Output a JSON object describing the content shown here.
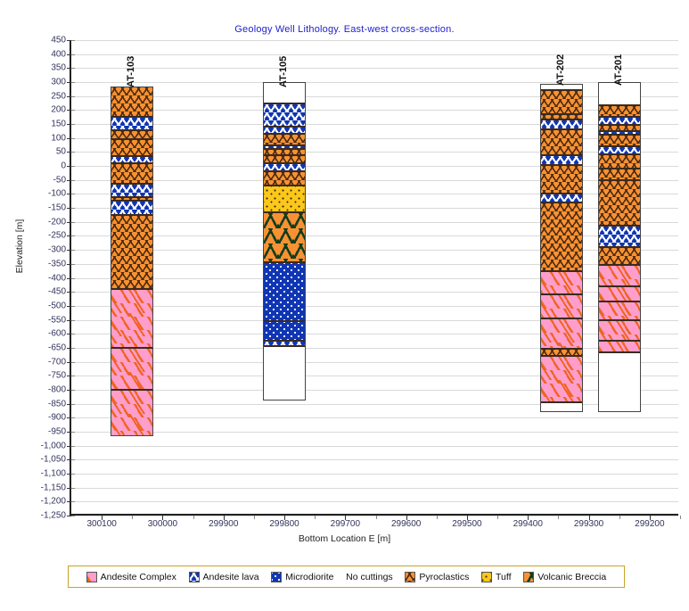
{
  "chart_title": "Geology Well Lithology.  East-west cross-section.",
  "axes": {
    "x_title": "Bottom Location E [m]",
    "y_title": "Elevation [m]",
    "x_ticks": [
      "300100",
      "300000",
      "299900",
      "299800",
      "299700",
      "299600",
      "299500",
      "299400",
      "299300",
      "299200"
    ],
    "y_ticks": [
      "450",
      "400",
      "350",
      "300",
      "250",
      "200",
      "150",
      "100",
      "50",
      "0",
      "-50",
      "-100",
      "-150",
      "-200",
      "-250",
      "-300",
      "-350",
      "-400",
      "-450",
      "-500",
      "-550",
      "-600",
      "-650",
      "-700",
      "-750",
      "-800",
      "-850",
      "-900",
      "-950",
      "-1,000",
      "-1,050",
      "-1,100",
      "-1,150",
      "-1,200",
      "-1,250"
    ]
  },
  "legend": {
    "items": [
      {
        "label": "Andesite Complex",
        "key": "andesite-complex",
        "color": "#ff9ecb"
      },
      {
        "label": "Andesite lava",
        "key": "andesite-lava",
        "color": "#1036b4"
      },
      {
        "label": "Microdiorite",
        "key": "microdiorite",
        "color": "#1036b4"
      },
      {
        "label": "No cuttings",
        "key": "no-cuttings",
        "color": "#ffffff"
      },
      {
        "label": "Pyroclastics",
        "key": "pyroclastics",
        "color": "#f79133"
      },
      {
        "label": "Tuff",
        "key": "tuff",
        "color": "#fbc71b"
      },
      {
        "label": "Volcanic Breccia",
        "key": "volcanic-breccia",
        "color": "#f79133"
      }
    ]
  },
  "chart_data": {
    "type": "bar",
    "title": "Geology Well Lithology.  East-west cross-section.",
    "xlabel": "Bottom Location E [m]",
    "ylabel": "Elevation [m]",
    "xlim": [
      300150,
      299150
    ],
    "ylim": [
      -1250,
      450
    ],
    "x_tick_step": 100,
    "y_tick_step": 50,
    "grid": true,
    "x_axis_reversed": true,
    "legend_position": "bottom",
    "units": "m",
    "wells": [
      {
        "name": "AT-103",
        "easting": 300050,
        "top": 285,
        "bottom": -965,
        "label_y": 300,
        "layers": [
          {
            "lithology": "Pyroclastics",
            "key": "pyroclastics",
            "top": 285,
            "bottom": 175
          },
          {
            "lithology": "Andesite lava",
            "key": "andesite-lava",
            "top": 175,
            "bottom": 128
          },
          {
            "lithology": "Pyroclastics",
            "key": "pyroclastics",
            "top": 128,
            "bottom": 95
          },
          {
            "lithology": "Pyroclastics",
            "key": "pyroclastics",
            "top": 95,
            "bottom": 35
          },
          {
            "lithology": "Andesite lava",
            "key": "andesite-lava",
            "top": 35,
            "bottom": 10
          },
          {
            "lithology": "Pyroclastics",
            "key": "pyroclastics",
            "top": 10,
            "bottom": -65
          },
          {
            "lithology": "Andesite lava",
            "key": "andesite-lava",
            "top": -65,
            "bottom": -110
          },
          {
            "lithology": "Pyroclastics",
            "key": "pyroclastics",
            "top": -110,
            "bottom": -125
          },
          {
            "lithology": "Andesite lava",
            "key": "andesite-lava",
            "top": -125,
            "bottom": -175
          },
          {
            "lithology": "Pyroclastics",
            "key": "pyroclastics",
            "top": -175,
            "bottom": -440
          },
          {
            "lithology": "Andesite Complex",
            "key": "andesite-complex",
            "top": -440,
            "bottom": -650
          },
          {
            "lithology": "Andesite Complex",
            "key": "andesite-complex",
            "top": -650,
            "bottom": -800
          },
          {
            "lithology": "Andesite Complex",
            "key": "andesite-complex",
            "top": -800,
            "bottom": -965
          }
        ]
      },
      {
        "name": "AT-105",
        "easting": 299800,
        "top": 300,
        "bottom": -840,
        "label_y": 300,
        "layers": [
          {
            "lithology": "No cuttings",
            "key": "no-cuttings",
            "top": 300,
            "bottom": 225
          },
          {
            "lithology": "Andesite lava",
            "key": "andesite-lava",
            "top": 225,
            "bottom": 140
          },
          {
            "lithology": "Andesite lava",
            "key": "andesite-lava",
            "top": 140,
            "bottom": 115
          },
          {
            "lithology": "Pyroclastics",
            "key": "pyroclastics",
            "top": 115,
            "bottom": 75
          },
          {
            "lithology": "Andesite lava",
            "key": "andesite-lava",
            "top": 75,
            "bottom": 62
          },
          {
            "lithology": "Pyroclastics",
            "key": "pyroclastics",
            "top": 62,
            "bottom": 40
          },
          {
            "lithology": "Pyroclastics",
            "key": "pyroclastics",
            "top": 40,
            "bottom": 10
          },
          {
            "lithology": "Andesite lava",
            "key": "andesite-lava",
            "top": 10,
            "bottom": -20
          },
          {
            "lithology": "Pyroclastics",
            "key": "pyroclastics",
            "top": -20,
            "bottom": -70
          },
          {
            "lithology": "Tuff",
            "key": "tuff",
            "top": -70,
            "bottom": -165
          },
          {
            "lithology": "Volcanic Breccia",
            "key": "volcanic-breccia",
            "top": -165,
            "bottom": -345
          },
          {
            "lithology": "Microdiorite",
            "key": "microdiorite",
            "top": -345,
            "bottom": -555
          },
          {
            "lithology": "Microdiorite",
            "key": "microdiorite",
            "top": -555,
            "bottom": -625
          },
          {
            "lithology": "Andesite lava",
            "key": "andesite-lava",
            "top": -625,
            "bottom": -645
          },
          {
            "lithology": "No cuttings",
            "key": "no-cuttings",
            "top": -645,
            "bottom": -840
          }
        ]
      },
      {
        "name": "AT-202",
        "easting": 299345,
        "top": 295,
        "bottom": -880,
        "label_y": 305,
        "layers": [
          {
            "lithology": "No cuttings",
            "key": "no-cuttings",
            "top": 295,
            "bottom": 270
          },
          {
            "lithology": "Pyroclastics",
            "key": "pyroclastics",
            "top": 270,
            "bottom": 185
          },
          {
            "lithology": "Pyroclastics",
            "key": "pyroclastics",
            "top": 185,
            "bottom": 165
          },
          {
            "lithology": "Andesite lava",
            "key": "andesite-lava",
            "top": 165,
            "bottom": 130
          },
          {
            "lithology": "Pyroclastics",
            "key": "pyroclastics",
            "top": 130,
            "bottom": 40
          },
          {
            "lithology": "Andesite lava",
            "key": "andesite-lava",
            "top": 40,
            "bottom": 5
          },
          {
            "lithology": "Pyroclastics",
            "key": "pyroclastics",
            "top": 5,
            "bottom": -100
          },
          {
            "lithology": "Andesite lava",
            "key": "andesite-lava",
            "top": -100,
            "bottom": -130
          },
          {
            "lithology": "Pyroclastics",
            "key": "pyroclastics",
            "top": -130,
            "bottom": -375
          },
          {
            "lithology": "Andesite Complex",
            "key": "andesite-complex",
            "top": -375,
            "bottom": -460
          },
          {
            "lithology": "Andesite Complex",
            "key": "andesite-complex",
            "top": -460,
            "bottom": -545
          },
          {
            "lithology": "Andesite Complex",
            "key": "andesite-complex",
            "top": -545,
            "bottom": -655
          },
          {
            "lithology": "Pyroclastics",
            "key": "pyroclastics",
            "top": -655,
            "bottom": -680
          },
          {
            "lithology": "Andesite Complex",
            "key": "andesite-complex",
            "top": -680,
            "bottom": -845
          },
          {
            "lithology": "No cuttings",
            "key": "no-cuttings",
            "top": -845,
            "bottom": -880
          }
        ]
      },
      {
        "name": "AT-201",
        "easting": 299250,
        "top": 300,
        "bottom": -880,
        "label_y": 305,
        "layers": [
          {
            "lithology": "No cuttings",
            "key": "no-cuttings",
            "top": 300,
            "bottom": 218
          },
          {
            "lithology": "Pyroclastics",
            "key": "pyroclastics",
            "top": 218,
            "bottom": 175
          },
          {
            "lithology": "Andesite lava",
            "key": "andesite-lava",
            "top": 175,
            "bottom": 148
          },
          {
            "lithology": "Pyroclastics",
            "key": "pyroclastics",
            "top": 148,
            "bottom": 125
          },
          {
            "lithology": "Andesite lava",
            "key": "andesite-lava",
            "top": 125,
            "bottom": 112
          },
          {
            "lithology": "Pyroclastics",
            "key": "pyroclastics",
            "top": 112,
            "bottom": 70
          },
          {
            "lithology": "Andesite lava",
            "key": "andesite-lava",
            "top": 70,
            "bottom": 42
          },
          {
            "lithology": "Pyroclastics",
            "key": "pyroclastics",
            "top": 42,
            "bottom": -10
          },
          {
            "lithology": "Pyroclastics",
            "key": "pyroclastics",
            "top": -10,
            "bottom": -50
          },
          {
            "lithology": "Pyroclastics",
            "key": "pyroclastics",
            "top": -50,
            "bottom": -215
          },
          {
            "lithology": "Andesite lava",
            "key": "andesite-lava",
            "top": -215,
            "bottom": -290
          },
          {
            "lithology": "Pyroclastics",
            "key": "pyroclastics",
            "top": -290,
            "bottom": -355
          },
          {
            "lithology": "Andesite Complex",
            "key": "andesite-complex",
            "top": -355,
            "bottom": -430
          },
          {
            "lithology": "Andesite Complex",
            "key": "andesite-complex",
            "top": -430,
            "bottom": -485
          },
          {
            "lithology": "Andesite Complex",
            "key": "andesite-complex",
            "top": -485,
            "bottom": -550
          },
          {
            "lithology": "Andesite Complex",
            "key": "andesite-complex",
            "top": -550,
            "bottom": -625
          },
          {
            "lithology": "Andesite Complex",
            "key": "andesite-complex",
            "top": -625,
            "bottom": -665
          },
          {
            "lithology": "No cuttings",
            "key": "no-cuttings",
            "top": -665,
            "bottom": -880
          }
        ]
      }
    ]
  }
}
